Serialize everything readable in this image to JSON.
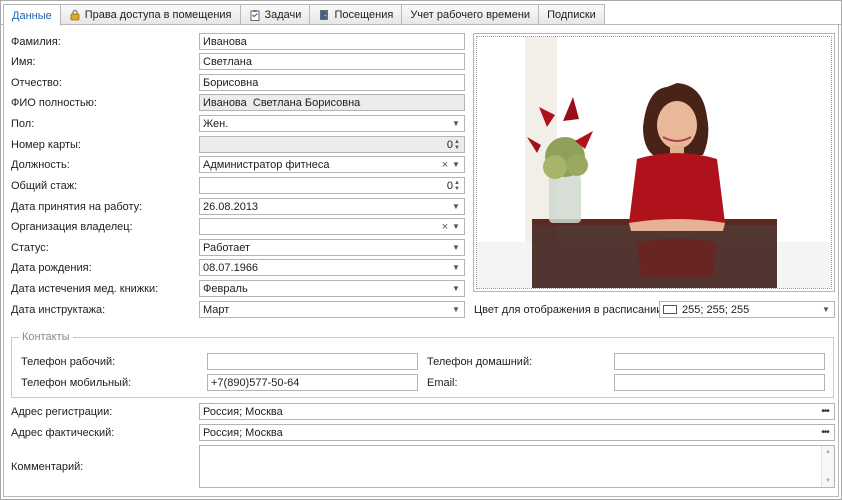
{
  "tabs": [
    {
      "label": "Данные",
      "icon": ""
    },
    {
      "label": "Права доступа в помещения",
      "icon": "lock-icon"
    },
    {
      "label": "Задачи",
      "icon": "clipboard-icon"
    },
    {
      "label": "Посещения",
      "icon": "door-icon"
    },
    {
      "label": "Учет рабочего времени",
      "icon": ""
    },
    {
      "label": "Подписки",
      "icon": ""
    }
  ],
  "form": {
    "last_name": {
      "label": "Фамилия:",
      "value": "Иванова"
    },
    "first_name": {
      "label": "Имя:",
      "value": "Светлана"
    },
    "patronymic": {
      "label": "Отчество:",
      "value": "Борисовна"
    },
    "full_name": {
      "label": "ФИО полностью:",
      "value": "Иванова  Светлана Борисовна"
    },
    "gender": {
      "label": "Пол:",
      "value": "Жен."
    },
    "card_number": {
      "label": "Номер карты:",
      "value": "0"
    },
    "position": {
      "label": "Должность:",
      "value": "Администратор фитнеса"
    },
    "experience": {
      "label": "Общий стаж:",
      "value": "0"
    },
    "hire_date": {
      "label": "Дата принятия на работу:",
      "value": "26.08.2013"
    },
    "owner_org": {
      "label": "Организация владелец:",
      "value": ""
    },
    "status": {
      "label": "Статус:",
      "value": "Работает"
    },
    "birth_date": {
      "label": "Дата рождения:",
      "value": "08.07.1966"
    },
    "med_book_expiry": {
      "label": "Дата истечения мед. книжки:",
      "value": "Февраль"
    },
    "briefing_date": {
      "label": "Дата инструктажа:",
      "value": "Март"
    },
    "schedule_color": {
      "label": "Цвет для отображения в расписании:",
      "value": "255; 255; 255",
      "swatch": "#ffffff"
    }
  },
  "contacts": {
    "title": "Контакты",
    "work_phone": {
      "label": "Телефон рабочий:",
      "value": ""
    },
    "mobile_phone": {
      "label": "Телефон мобильный:",
      "value": "+7(890)577-50-64"
    },
    "home_phone": {
      "label": "Телефон домашний:",
      "value": ""
    },
    "email": {
      "label": "Email:",
      "value": ""
    }
  },
  "address": {
    "registration": {
      "label": "Адрес регистрации:",
      "value": "Россия; Москва"
    },
    "actual": {
      "label": "Адрес фактический:",
      "value": "Россия; Москва"
    }
  },
  "comment": {
    "label": "Комментарий:",
    "value": ""
  },
  "colors": {
    "accent": "#1e64b4",
    "border": "#b4b4b4",
    "readonly_bg": "#ececec",
    "photo_dress": "#b0121c"
  }
}
